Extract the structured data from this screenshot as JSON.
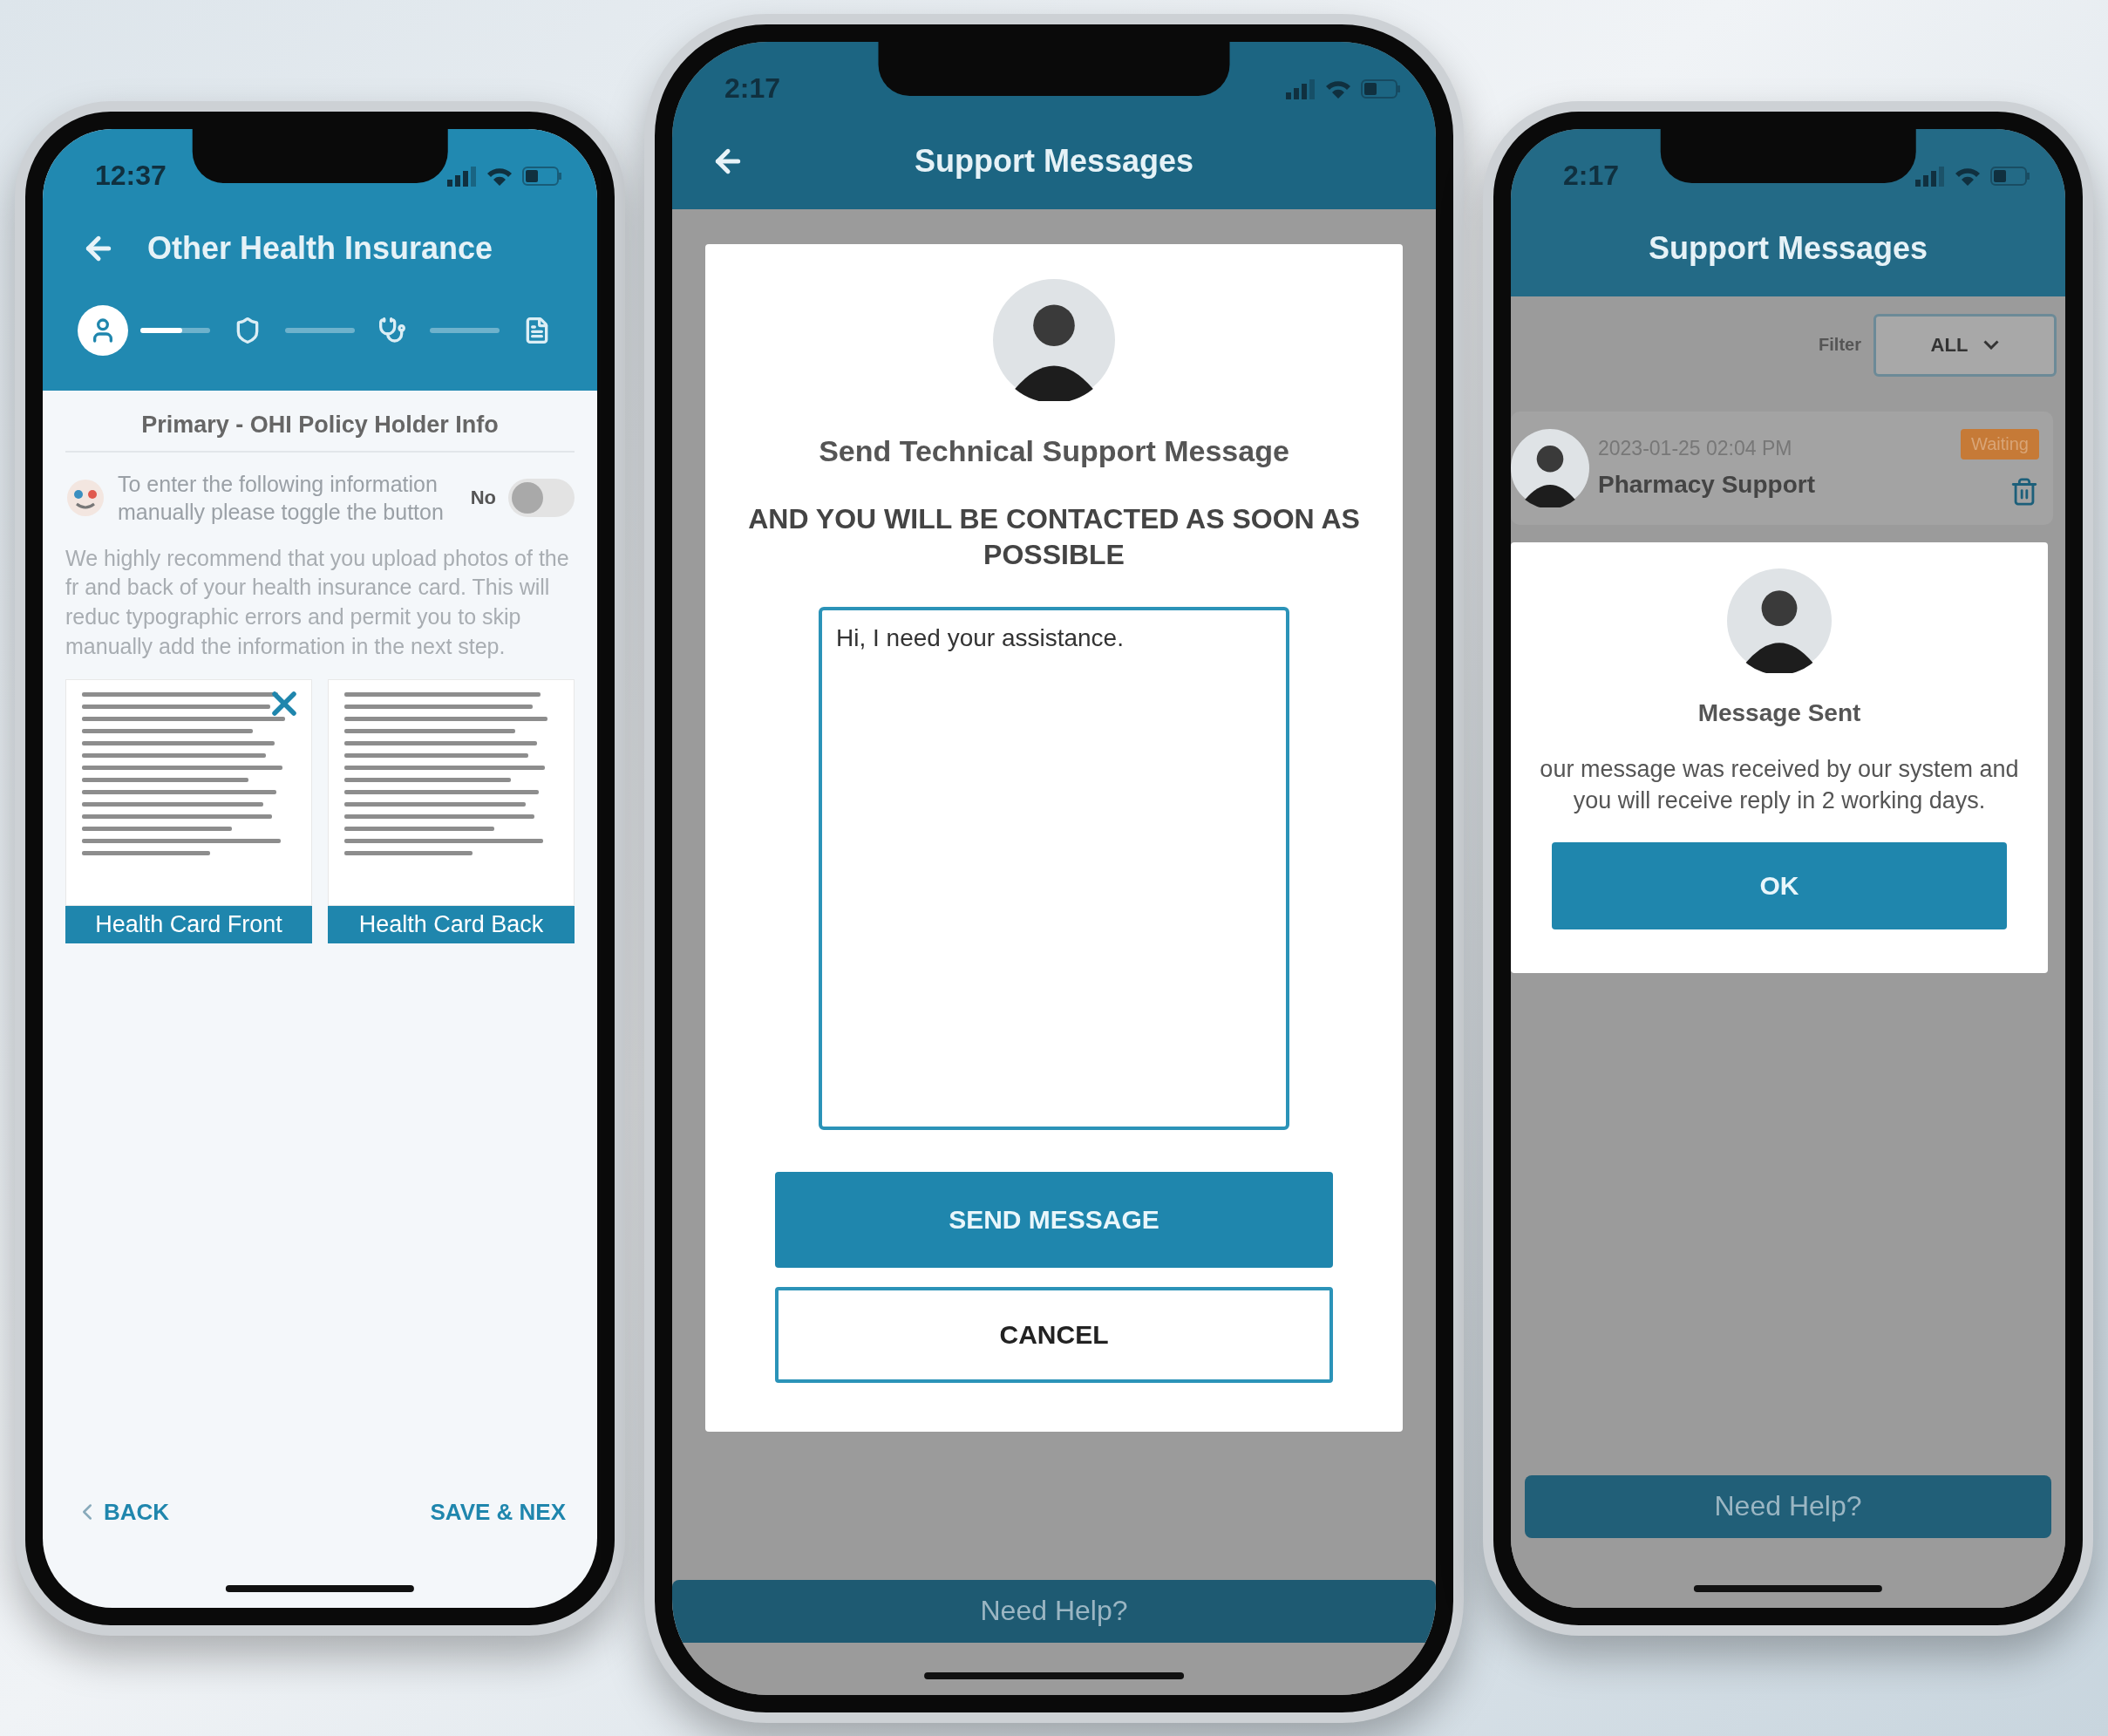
{
  "left_phone": {
    "status_bar": {
      "time": "12:37"
    },
    "header": {
      "title": "Other Health Insurance",
      "back_button": true
    },
    "stepper": {
      "steps": [
        {
          "selected": true
        },
        {
          "selected": false
        },
        {
          "selected": false
        },
        {
          "selected": false
        }
      ],
      "connectors": [
        {
          "level": 0.6
        }
      ]
    },
    "section_title": "Primary - OHI Policy Holder Info",
    "manual_toggle": {
      "label": "To enter the following information manually please toggle the button",
      "value_label": "No",
      "on": false
    },
    "recommendation": "We highly recommend that you upload photos of the fr and back of your health insurance card. This will reduc typographic errors and permit you to skip manually add the information in the next step.",
    "cards": [
      {
        "label": "Health Card Front",
        "removable": true
      },
      {
        "label": "Health Card Back",
        "removable": false
      }
    ],
    "footer": {
      "back": "BACK",
      "next": "SAVE & NEX"
    }
  },
  "center_phone": {
    "status_bar": {
      "time": "2:17"
    },
    "header": {
      "title": "Support Messages",
      "back_button": true
    },
    "dialog": {
      "title": "Send Technical Support Message",
      "subtitle": "AND YOU WILL BE CONTACTED AS SOON AS POSSIBLE",
      "message": "Hi, I need your assistance.",
      "buttons": [
        {
          "label": "SEND MESSAGE",
          "kind": "primary"
        },
        {
          "label": "CANCEL",
          "kind": "secondary"
        }
      ]
    },
    "help_bar": "Need Help?"
  },
  "right_phone": {
    "status_bar": {
      "time": "2:17"
    },
    "header": {
      "title": "Support Messages"
    },
    "filter": {
      "label": "Filter",
      "value": "ALL"
    },
    "messages": [
      {
        "date": "2023-01-25 02:04 PM",
        "name": "Pharmacy Support",
        "status": "Waiting"
      }
    ],
    "dialog": {
      "title": "Message Sent",
      "body": "our message was received by our system and you will receive reply in 2 working days.",
      "buttons": [
        {
          "label": "OK",
          "kind": "primary"
        }
      ]
    },
    "help_bar": "Need Help?"
  }
}
